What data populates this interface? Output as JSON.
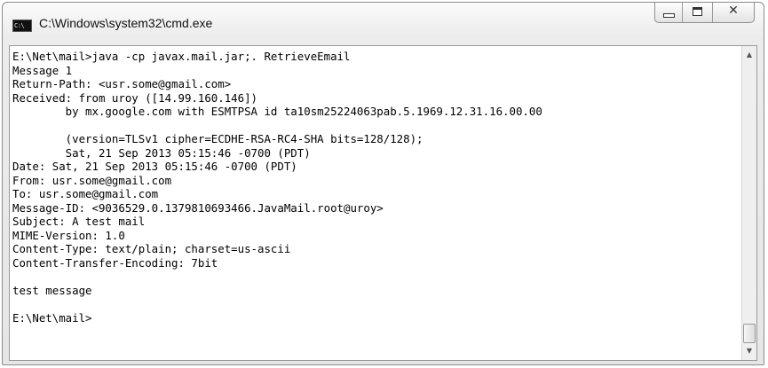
{
  "window": {
    "title": "C:\\Windows\\system32\\cmd.exe",
    "app_icon_text": "C:\\",
    "controls": {
      "minimize": "minimize",
      "maximize": "maximize",
      "close": "✕"
    }
  },
  "console": {
    "lines": [
      "E:\\Net\\mail>java -cp javax.mail.jar;. RetrieveEmail",
      "Message 1",
      "Return-Path: <usr.some@gmail.com>",
      "Received: from uroy ([14.99.160.146])",
      "        by mx.google.com with ESMTPSA id ta10sm25224063pab.5.1969.12.31.16.00.00",
      "",
      "        (version=TLSv1 cipher=ECDHE-RSA-RC4-SHA bits=128/128);",
      "        Sat, 21 Sep 2013 05:15:46 -0700 (PDT)",
      "Date: Sat, 21 Sep 2013 05:15:46 -0700 (PDT)",
      "From: usr.some@gmail.com",
      "To: usr.some@gmail.com",
      "Message-ID: <9036529.0.1379810693466.JavaMail.root@uroy>",
      "Subject: A test mail",
      "MIME-Version: 1.0",
      "Content-Type: text/plain; charset=us-ascii",
      "Content-Transfer-Encoding: 7bit",
      "",
      "test message",
      "",
      "E:\\Net\\mail>"
    ]
  },
  "scrollbar": {
    "up_icon": "arrow-up-icon",
    "down_icon": "arrow-down-icon"
  }
}
